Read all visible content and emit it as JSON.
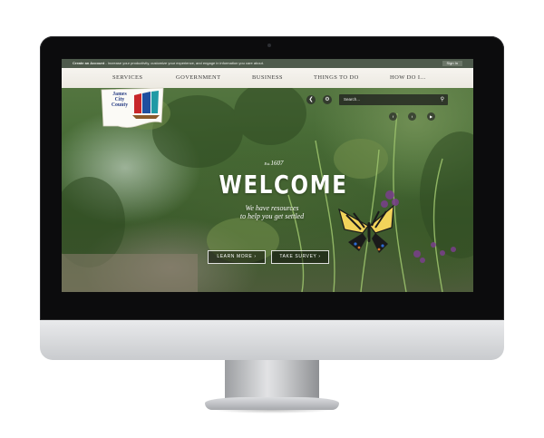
{
  "account_bar": {
    "create_label": "Create an Account",
    "create_desc": " - Increase your productivity, customize your experience, and engage in information you care about.",
    "sign_in": "Sign In"
  },
  "nav": {
    "items": [
      "SERVICES",
      "GOVERNMENT",
      "BUSINESS",
      "THINGS TO DO",
      "HOW DO I..."
    ]
  },
  "logo": {
    "line1": "James",
    "line2": "City",
    "line3": "County"
  },
  "search": {
    "placeholder": "Search..."
  },
  "icons": {
    "share": "share-icon",
    "settings": "gear-icon",
    "search": "search-icon",
    "facebook": "facebook-icon",
    "twitter": "twitter-icon",
    "youtube": "youtube-icon"
  },
  "hero": {
    "est_prefix": "Est.",
    "est_year": "1607",
    "heading": "WELCOME",
    "tagline_1": "We have resources",
    "tagline_2": "to help you get settled",
    "learn_more": "LEARN MORE ›",
    "take_survey": "TAKE SURVEY ›"
  },
  "colors": {
    "account_bar": "#4e5a4c",
    "nav_bg": "#f2f0ea",
    "logo_blue": "#2a3f86",
    "logo_red": "#c8262b",
    "logo_teal": "#1f9aa5"
  }
}
